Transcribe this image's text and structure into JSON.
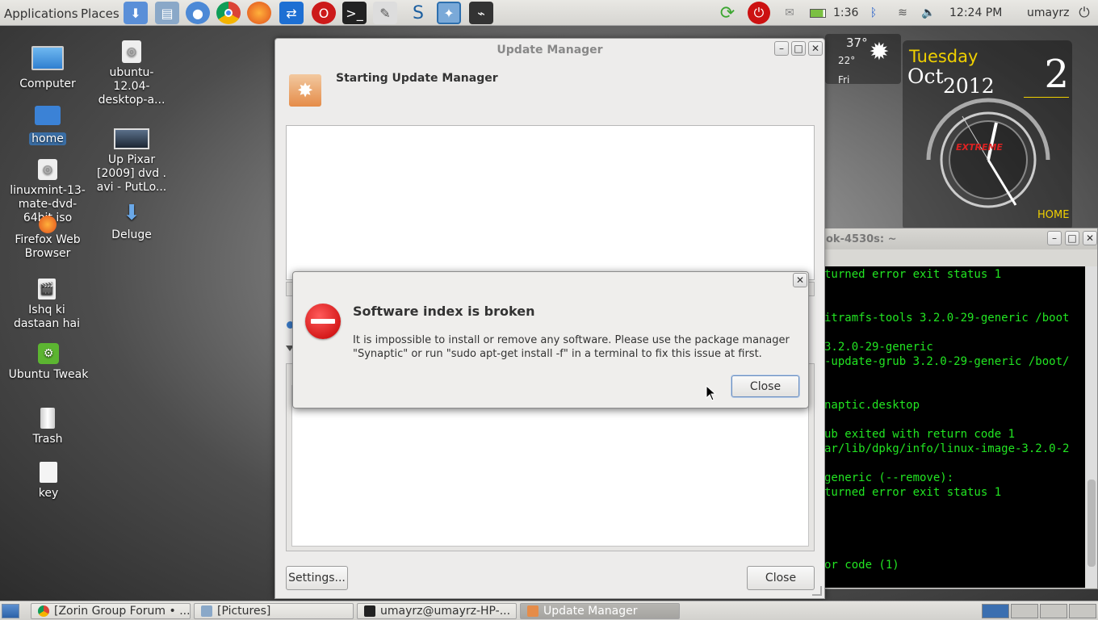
{
  "top_panel": {
    "menus": [
      "Applications",
      "Places"
    ],
    "launchers": [
      "download-icon",
      "file-manager-icon",
      "chromium-icon",
      "chrome-icon",
      "firefox-icon",
      "teamviewer-icon",
      "opera-icon",
      "terminal-icon",
      "text-editor-icon",
      "zorin-icon",
      "screenshot-icon",
      "system-monitor-icon"
    ],
    "battery_time": "1:36",
    "clock": "12:24 PM",
    "user": "umayrz"
  },
  "desktop_icons": [
    {
      "label": "Computer"
    },
    {
      "label": "home"
    },
    {
      "label": "linuxmint-13-mate-dvd-64bit.iso"
    },
    {
      "label": "Firefox Web Browser"
    },
    {
      "label": "Ishq ki dastaan hai"
    },
    {
      "label": "Ubuntu Tweak"
    },
    {
      "label": "Trash"
    },
    {
      "label": "key"
    },
    {
      "label": "ubuntu-12.04-desktop-a..."
    },
    {
      "label": "Up Pixar [2009] dvd . avi - PutLo..."
    },
    {
      "label": "Deluge"
    }
  ],
  "weather": {
    "high": "37°",
    "low": "22°",
    "day": "Fri"
  },
  "clock_widget": {
    "weekday": "Tuesday",
    "month": "Oct",
    "year": "2012",
    "day": "2",
    "logo": "EXTREME",
    "location": "HOME"
  },
  "terminal": {
    "title": "ok-4530s: ~",
    "lines": [
      "turned error exit status 1",
      "itramfs-tools 3.2.0-29-generic /boot",
      "3.2.0-29-generic",
      "-update-grub 3.2.0-29-generic /boot/",
      "naptic.desktop",
      "ub exited with return code 1",
      "ar/lib/dpkg/info/linux-image-3.2.0-2",
      "generic (--remove):",
      "turned error exit status 1",
      "or code (1)"
    ]
  },
  "update_manager": {
    "title": "Update Manager",
    "heading": "Starting Update Manager",
    "settings_button": "Settings...",
    "close_button": "Close"
  },
  "dialog": {
    "title": "Software index is broken",
    "message_line1": "It is impossible to install or remove any software. Please use the package manager",
    "message_line2": "\"Synaptic\" or run \"sudo apt-get install -f\" in a terminal to fix this issue at first.",
    "close_button": "Close"
  },
  "taskbar": {
    "tasks": [
      {
        "label": "[Zorin Group Forum • ...",
        "active": false
      },
      {
        "label": "[Pictures]",
        "active": false
      },
      {
        "label": "umayrz@umayrz-HP-...",
        "active": false
      },
      {
        "label": "Update Manager",
        "active": true
      }
    ]
  },
  "colors": {
    "terminal_text": "#22e522",
    "error_red": "#d41111",
    "clock_accent": "#f0d000"
  }
}
